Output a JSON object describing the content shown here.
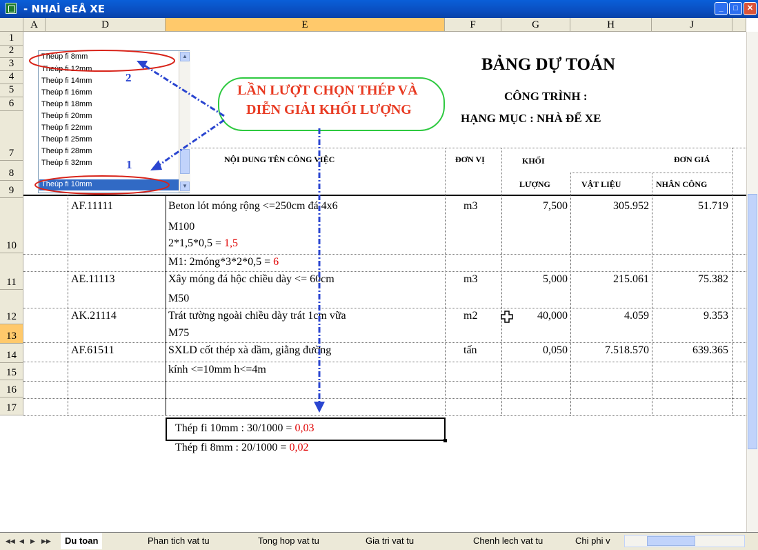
{
  "window": {
    "title": "- NHAÌ eEÅ XE"
  },
  "columns": [
    "A",
    "D",
    "E",
    "F",
    "G",
    "H",
    "J"
  ],
  "rows": [
    "1",
    "2",
    "3",
    "4",
    "5",
    "6",
    "7",
    "8",
    "9",
    "10",
    "11",
    "12",
    "13",
    "14",
    "15",
    "16",
    "17"
  ],
  "dropdown": {
    "items": [
      "Theùp fi 8mm",
      "Theùp fi 12mm",
      "Theùp fi 14mm",
      "Theùp fi 16mm",
      "Theùp fi 18mm",
      "Theùp fi 20mm",
      "Theùp fi 22mm",
      "Theùp fi 25mm",
      "Theùp fi 28mm",
      "Theùp fi 32mm",
      "Theùp fi 10mm"
    ],
    "selected": "Theùp fi 10mm"
  },
  "header": {
    "title": "BẢNG DỰ TOÁN",
    "cong_trinh": "CÔNG TRÌNH :",
    "hang_muc": "HẠNG MỤC : NHÀ ĐỂ XE",
    "col_noi_dung": "NỘI DUNG TÊN CÔNG VIỆC",
    "col_don_vi": "ĐƠN VỊ",
    "col_khoi": "KHỐI",
    "col_luong": "LƯỢNG",
    "col_don_gia": "ĐƠN GIÁ",
    "col_vat_lieu": "VẬT LIỆU",
    "col_nhan_cong": "NHÂN CÔNG"
  },
  "annotation": {
    "line1": "LẦN LƯỢT CHỌN THÉP VÀ",
    "line2": "DIỄN GIẢI KHỐI LƯỢNG",
    "marker1": "1",
    "marker2": "2"
  },
  "table": {
    "r7": {
      "code": "AF.11111",
      "desc1": "Beton lót móng rộng <=250cm đá 4x6",
      "desc2": "M100",
      "unit": "m3",
      "qty": "7,500",
      "vl": "305.952",
      "nc": "51.719"
    },
    "r8": {
      "text": "2*1,5*0,5 = ",
      "red": "1,5"
    },
    "r9": {
      "text": "M1: 2móng*3*2*0,5 = ",
      "red": "6"
    },
    "r10": {
      "code": "AE.11113",
      "desc1": "Xây móng đá hộc chiều dày <= 60cm",
      "desc2": "M50",
      "unit": "m3",
      "qty": "5,000",
      "vl": "215.061",
      "nc": "75.382"
    },
    "r11": {
      "code": "AK.21114",
      "desc1": "Trát tường ngoài chiều dày trát 1cm vữa",
      "desc2": "M75",
      "unit": "m2",
      "qty": "40,000",
      "vl": "4.059",
      "nc": "9.353"
    },
    "r12": {
      "code": "AF.61511",
      "desc1": "SXLD cốt thép xà dầm, giằng đường",
      "desc2": "kính <=10mm h<=4m",
      "unit": "tấn",
      "qty": "0,050",
      "vl": "7.518.570",
      "nc": "639.365"
    },
    "r13": {
      "text": "Thép fi 10mm  : 30/1000 = ",
      "red": "0,03"
    },
    "r14": {
      "text": "Thép fi 8mm  : 20/1000 = ",
      "red": "0,02"
    }
  },
  "tabs": {
    "nav": [
      "◀◀",
      "◀",
      "▶",
      "▶▶"
    ],
    "items": [
      "Du toan",
      "Phan tich vat tu",
      "Tong hop vat tu",
      "Gia tri vat tu",
      "Chenh lech vat tu",
      "Chi phi v"
    ]
  }
}
